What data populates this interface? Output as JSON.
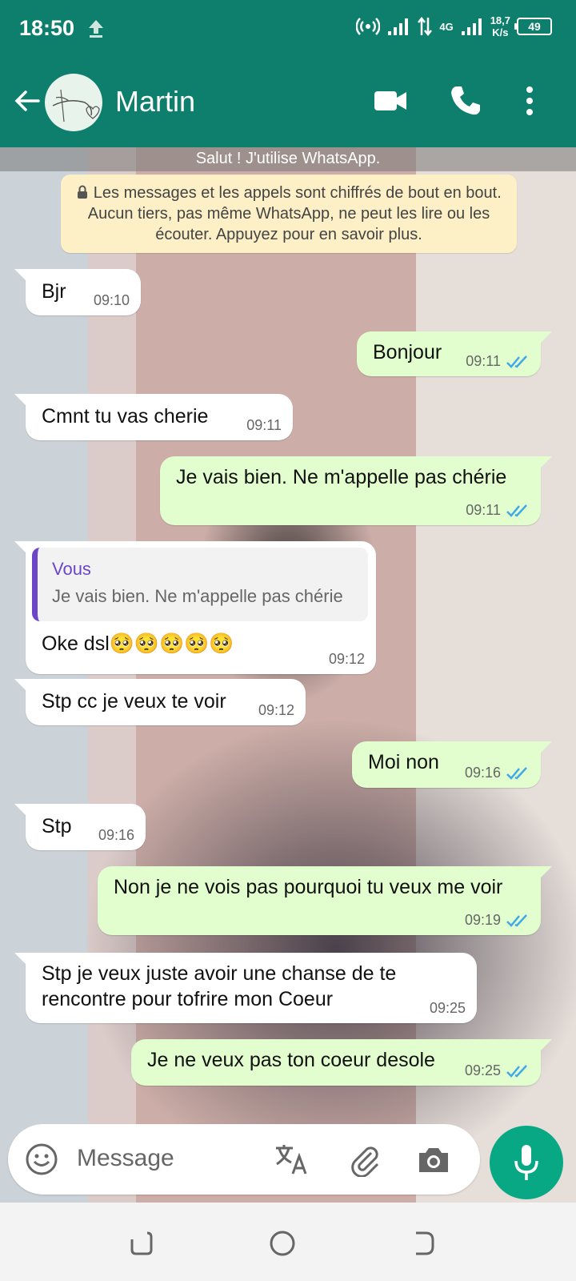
{
  "status_bar": {
    "time": "18:50",
    "network_4g": "4G",
    "speed_value": "18,7",
    "speed_unit": "K/s",
    "battery": "49"
  },
  "header": {
    "contact_name": "Martin",
    "icons": [
      "back-arrow-icon",
      "video-call-icon",
      "phone-icon",
      "more-vert-icon"
    ]
  },
  "chat": {
    "about": "Salut ! J'utilise WhatsApp.",
    "encryption_notice": "Les messages et les appels sont chiffrés de bout en bout. Aucun tiers, pas même WhatsApp, ne peut les lire ou les écouter. Appuyez pour en savoir plus.",
    "messages": [
      {
        "dir": "in",
        "text": "Bjr",
        "time": "09:10"
      },
      {
        "dir": "out",
        "text": "Bonjour",
        "time": "09:11",
        "read": true
      },
      {
        "dir": "in",
        "text": "Cmnt tu vas cherie",
        "time": "09:11"
      },
      {
        "dir": "out",
        "text": "Je vais bien. Ne m'appelle pas chérie",
        "time": "09:11",
        "read": true
      },
      {
        "dir": "in",
        "reply_to": {
          "author": "Vous",
          "text": "Je vais bien. Ne m'appelle pas chérie"
        },
        "text": "Oke dsl🥺🥺🥺🥺🥺",
        "time": "09:12"
      },
      {
        "dir": "in",
        "text": "Stp cc je veux te voir",
        "time": "09:12"
      },
      {
        "dir": "out",
        "text": "Moi non",
        "time": "09:16",
        "read": true
      },
      {
        "dir": "in",
        "text": "Stp",
        "time": "09:16"
      },
      {
        "dir": "out",
        "text": "Non je ne vois pas pourquoi tu veux me voir",
        "time": "09:19",
        "read": true
      },
      {
        "dir": "in",
        "text_line1": "Stp je veux juste avoir une chanse de te",
        "text_line2": "rencontre pour tofrire mon Coeur",
        "time": "09:25"
      },
      {
        "dir": "out",
        "text": "Je ne veux pas ton coeur desole",
        "time": "09:25",
        "read": true
      }
    ]
  },
  "composer": {
    "placeholder": "Message"
  },
  "colors": {
    "header": "#0d7f6c",
    "outgoing_bubble": "#e2fecf",
    "incoming_bubble": "#ffffff",
    "mic_button": "#08a884",
    "read_ticks": "#3fa9e8",
    "reply_accent": "#6c46c8"
  }
}
